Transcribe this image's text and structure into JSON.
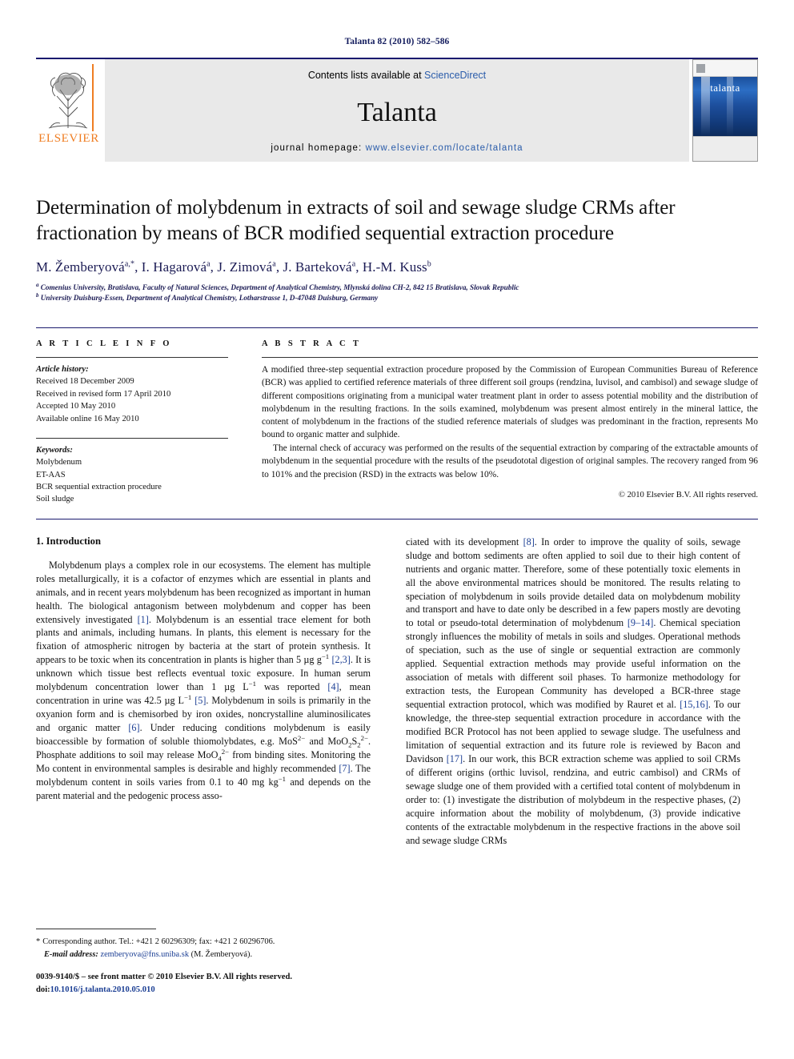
{
  "running_head": "Talanta 82 (2010) 582–586",
  "masthead": {
    "publisher_logo_text": "ELSEVIER",
    "contents_prefix": "Contents lists available at",
    "contents_link": "ScienceDirect",
    "journal_name": "Talanta",
    "homepage_prefix": "journal homepage:",
    "homepage_url": "www.elsevier.com/locate/talanta",
    "cover_title": "talanta"
  },
  "article": {
    "title": "Determination of molybdenum in extracts of soil and sewage sludge CRMs after fractionation by means of BCR modified sequential extraction procedure",
    "authors_html": "M. Žemberyová<sup>a,*</sup>, I. Hagarová<sup>a</sup>, J. Zimová<sup>a</sup>, J. Barteková<sup>a</sup>, H.-M. Kuss<sup>b</sup>",
    "affiliations": [
      "Comenius University, Bratislava, Faculty of Natural Sciences, Department of Analytical Chemistry, Mlynská dolina CH-2, 842 15 Bratislava, Slovak Republic",
      "University Duisburg-Essen, Department of Analytical Chemistry, Lotharstrasse 1, D-47048 Duisburg, Germany"
    ]
  },
  "info": {
    "heading": "A R T I C L E   I N F O",
    "history_label": "Article history:",
    "history": [
      "Received 18 December 2009",
      "Received in revised form 17 April 2010",
      "Accepted 10 May 2010",
      "Available online 16 May 2010"
    ],
    "keywords_label": "Keywords:",
    "keywords": [
      "Molybdenum",
      "ET-AAS",
      "BCR sequential extraction procedure",
      "Soil sludge"
    ]
  },
  "abstract": {
    "heading": "A B S T R A C T",
    "paragraphs": [
      "A modified three-step sequential extraction procedure proposed by the Commission of European Communities Bureau of Reference (BCR) was applied to certified reference materials of three different soil groups (rendzina, luvisol, and cambisol) and sewage sludge of different compositions originating from a municipal water treatment plant in order to assess potential mobility and the distribution of molybdenum in the resulting fractions. In the soils examined, molybdenum was present almost entirely in the mineral lattice, the content of molybdenum in the fractions of the studied reference materials of sludges was predominant in the fraction, represents Mo bound to organic matter and sulphide.",
      "The internal check of accuracy was performed on the results of the sequential extraction by comparing of the extractable amounts of molybdenum in the sequential procedure with the results of the pseudototal digestion of original samples. The recovery ranged from 96 to 101% and the precision (RSD) in the extracts was below 10%."
    ],
    "copyright": "© 2010 Elsevier B.V. All rights reserved."
  },
  "intro": {
    "section_title": "1. Introduction",
    "left_paragraph_html": "Molybdenum plays a complex role in our ecosystems. The element has multiple roles metallurgically, it is a cofactor of enzymes which are essential in plants and animals, and in recent years molybdenum has been recognized as important in human health. The biological antagonism between molybdenum and copper has been extensively investigated <span class=\"ref\">[1]</span>. Molybdenum is an essential trace element for both plants and animals, including humans. In plants, this element is necessary for the fixation of atmospheric nitrogen by bacteria at the start of protein synthesis. It appears to be toxic when its concentration in plants is higher than 5 µg g<sup>−1</sup> <span class=\"ref\">[2,3]</span>. It is unknown which tissue best reflects eventual toxic exposure. In human serum molybdenum concentration lower than 1 µg L<sup>−1</sup> was reported <span class=\"ref\">[4]</span>, mean concentration in urine was 42.5 µg L<sup>−1</sup> <span class=\"ref\">[5]</span>. Molybdenum in soils is primarily in the oxyanion form and is chemisorbed by iron oxides, noncrystalline aluminosilicates and organic matter <span class=\"ref\">[6]</span>. Under reducing conditions molybdenum is easily bioaccessible by formation of soluble thiomolybdates, e.g. MoS<sup>2−</sup> and MoO<sub>2</sub>S<sub>2</sub><sup>2−</sup>. Phosphate additions to soil may release MoO<sub>4</sub><sup>2−</sup> from binding sites. Monitoring the Mo content in environmental samples is desirable and highly recommended <span class=\"ref\">[7]</span>. The molybdenum content in soils varies from 0.1 to 40 mg kg<sup>−1</sup> and depends on the parent material and the pedogenic process asso-",
    "right_paragraph_html": "ciated with its development <span class=\"ref\">[8]</span>. In order to improve the quality of soils, sewage sludge and bottom sediments are often applied to soil due to their high content of nutrients and organic matter. Therefore, some of these potentially toxic elements in all the above environmental matrices should be monitored. The results relating to speciation of molybdenum in soils provide detailed data on molybdenum mobility and transport and have to date only be described in a few papers mostly are devoting to total or pseudo-total determination of molybdenum <span class=\"ref\">[9–14]</span>. Chemical speciation strongly influences the mobility of metals in soils and sludges. Operational methods of speciation, such as the use of single or sequential extraction are commonly applied. Sequential extraction methods may provide useful information on the association of metals with different soil phases. To harmonize methodology for extraction tests, the European Community has developed a BCR-three stage sequential extraction protocol, which was modified by Rauret et al. <span class=\"ref\">[15,16]</span>. To our knowledge, the three-step sequential extraction procedure in accordance with the modified BCR Protocol has not been applied to sewage sludge. The usefulness and limitation of sequential extraction and its future role is reviewed by Bacon and Davidson <span class=\"ref\">[17]</span>. In our work, this BCR extraction scheme was applied to soil CRMs of different origins (orthic luvisol, rendzina, and eutric cambisol) and CRMs of sewage sludge one of them provided with a certified total content of molybdenum in order to: (1) investigate the distribution of molybdeum in the respective phases, (2) acquire information about the mobility of molybdenum, (3) provide indicative contents of the extractable molybdenum in the respective fractions in the above soil and sewage sludge CRMs"
  },
  "footer": {
    "corresponding_note": "Corresponding author. Tel.: +421 2 60296309; fax: +421 2 60296706.",
    "email_label": "E-mail address:",
    "email": "zemberyova@fns.uniba.sk",
    "email_suffix": "(M. Žemberyová).",
    "issn_line": "0039-9140/$ – see front matter © 2010 Elsevier B.V. All rights reserved.",
    "doi_label": "doi:",
    "doi_value": "10.1016/j.talanta.2010.05.010"
  }
}
